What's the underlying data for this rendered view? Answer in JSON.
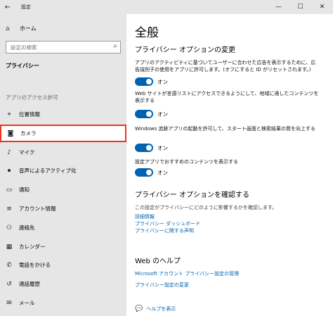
{
  "window": {
    "title": "設定",
    "back_icon": "←",
    "minimize_icon": "—",
    "maximize_icon": "☐",
    "close_icon": "✕"
  },
  "sidebar": {
    "home_label": "ホーム",
    "home_icon": "⌂",
    "search_placeholder": "設定の検索",
    "search_icon": "⌕",
    "section_title": "プライバシー",
    "group_label": "アプリのアクセス許可",
    "items": [
      {
        "label": "位置情報",
        "icon": "⌖"
      },
      {
        "label": "カメラ",
        "icon": "◙"
      },
      {
        "label": "マイク",
        "icon": "♪"
      },
      {
        "label": "音声によるアクティブ化",
        "icon": "⏺"
      },
      {
        "label": "通知",
        "icon": "▭"
      },
      {
        "label": "アカウント情報",
        "icon": "≡"
      },
      {
        "label": "連絡先",
        "icon": "⚇"
      },
      {
        "label": "カレンダー",
        "icon": "▦"
      },
      {
        "label": "電話をかける",
        "icon": "✆"
      },
      {
        "label": "通話履歴",
        "icon": "↺"
      },
      {
        "label": "メール",
        "icon": "✉"
      }
    ]
  },
  "main": {
    "title": "全般",
    "section1_title": "プライバシー オプションの変更",
    "options": [
      {
        "text": "アプリのアクティビティに基づいてユーザーに合わせた広告を表示するために、広告識別子の使用をアプリに許可します。(オフにすると ID がリセットされます。)",
        "state": "オン"
      },
      {
        "text": "Web サイトが言語リストにアクセスできるようにして、地域に適したコンテンツを表示する",
        "state": "オン"
      },
      {
        "text": "Windows 追跡アプリの起動を許可して、スタート画面と検索結果の質を向上する",
        "state": "オン"
      },
      {
        "text": "設定アプリでおすすめのコンテンツを表示する",
        "state": "オン"
      }
    ],
    "section2_title": "プライバシー オプションを確認する",
    "section2_desc": "この設定がプライバシーにどのように影響するかを確認します。",
    "section2_links": [
      "詳細情報",
      "プライバシー ダッシュボード",
      "プライバシーに関する声明"
    ],
    "section3_title": "Web のヘルプ",
    "section3_links": [
      "Microsoft アカウント プライバシー設定の管理",
      "プライバシー設定の変更"
    ],
    "help_label": "ヘルプを表示",
    "help_icon": "💬"
  }
}
